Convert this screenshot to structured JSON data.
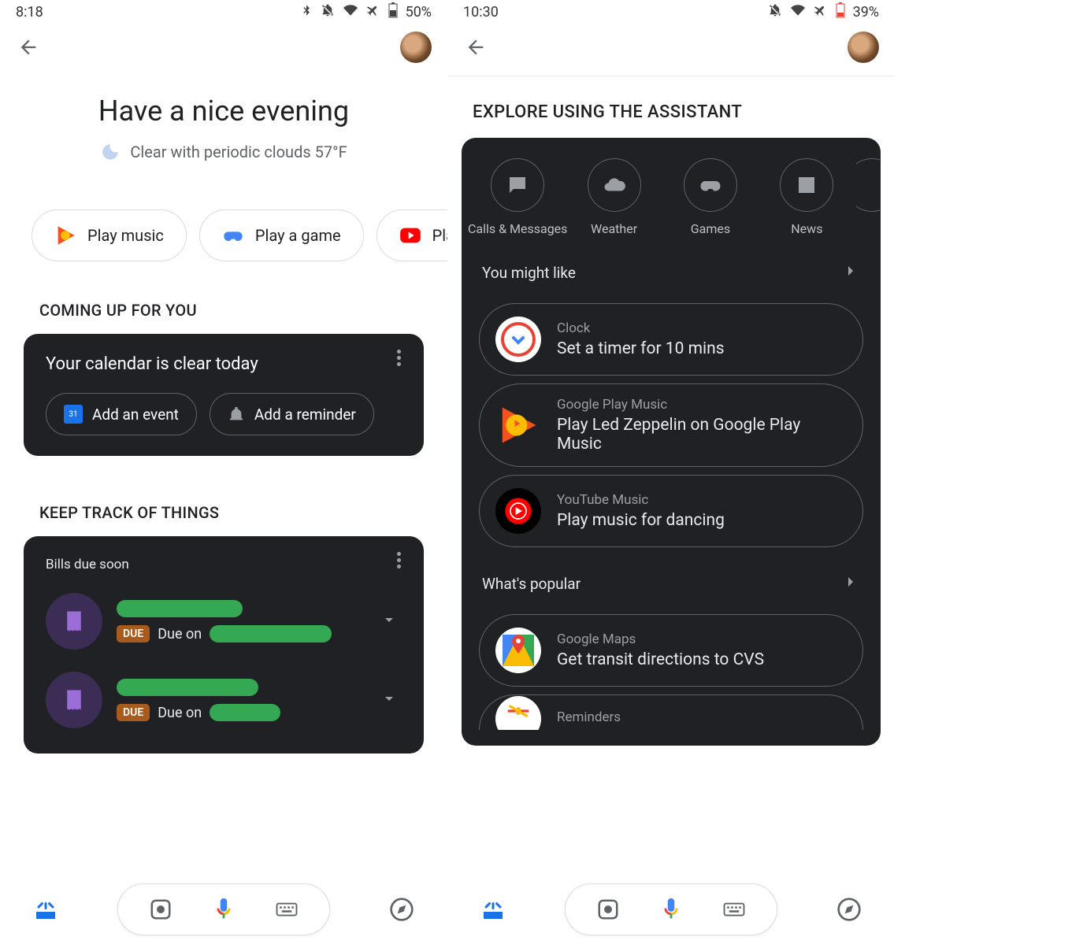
{
  "left": {
    "status": {
      "time": "8:18",
      "battery": "50%"
    },
    "greeting": "Have a nice evening",
    "weather": "Clear with periodic clouds 57°F",
    "chips": [
      {
        "label": "Play music"
      },
      {
        "label": "Play a game"
      },
      {
        "label": "Pla"
      }
    ],
    "coming_up_header": "COMING UP FOR YOU",
    "calendar_text": "Your calendar is clear today",
    "add_event_label": "Add an event",
    "add_reminder_label": "Add a reminder",
    "keep_track_header": "KEEP TRACK OF THINGS",
    "bills_title": "Bills due soon",
    "due_badge": "DUE",
    "due_on": "Due on"
  },
  "right": {
    "status": {
      "time": "10:30",
      "battery": "39%"
    },
    "explore_header": "EXPLORE USING THE ASSISTANT",
    "categories": [
      {
        "label": "Calls & Messages"
      },
      {
        "label": "Weather"
      },
      {
        "label": "Games"
      },
      {
        "label": "News"
      }
    ],
    "you_might_like": "You might like",
    "suggestions": [
      {
        "app": "Clock",
        "action": "Set a timer for 10 mins"
      },
      {
        "app": "Google Play Music",
        "action": "Play Led Zeppelin on Google Play Music"
      },
      {
        "app": "YouTube Music",
        "action": "Play music for dancing"
      }
    ],
    "whats_popular": "What's popular",
    "popular": [
      {
        "app": "Google Maps",
        "action": "Get transit directions to CVS"
      },
      {
        "app": "Reminders",
        "action": ""
      }
    ]
  }
}
